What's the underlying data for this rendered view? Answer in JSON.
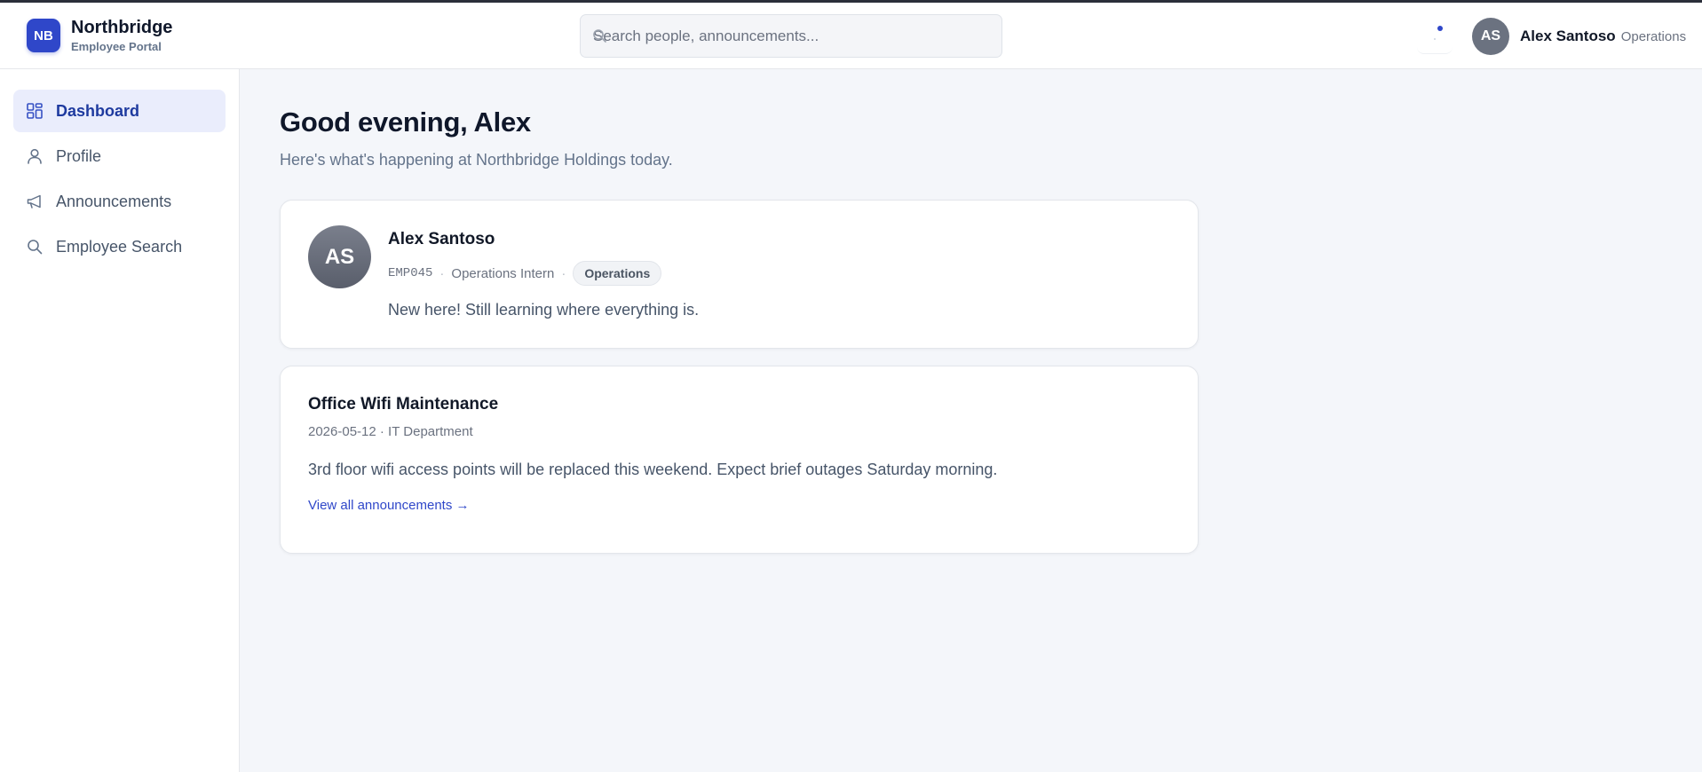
{
  "header": {
    "brand_initials": "NB",
    "brand_name": "Northbridge",
    "brand_subtitle": "Employee Portal",
    "search_placeholder": "Search people, announcements...",
    "user_initials": "AS",
    "user_name": "Alex Santoso",
    "user_department": "Operations"
  },
  "sidebar": {
    "items": [
      {
        "label": "Dashboard",
        "icon": "dashboard-grid-icon",
        "active": true
      },
      {
        "label": "Profile",
        "icon": "user-icon",
        "active": false
      },
      {
        "label": "Announcements",
        "icon": "megaphone-icon",
        "active": false
      },
      {
        "label": "Employee Search",
        "icon": "search-icon",
        "active": false
      }
    ]
  },
  "main": {
    "greeting": "Good evening, Alex",
    "subtitle": "Here's what's happening at Northbridge Holdings today.",
    "profile_card": {
      "initials": "AS",
      "name": "Alex Santoso",
      "employee_id": "EMP045",
      "separator": "·",
      "role": "Operations Intern",
      "department_badge": "Operations",
      "bio": "New here! Still learning where everything is."
    },
    "announcement_card": {
      "title": "Office Wifi Maintenance",
      "meta": "2026-05-12 · IT Department",
      "body": "3rd floor wifi access points will be replaced this weekend. Expect brief outages Saturday morning.",
      "link_label": "View all announcements →"
    }
  },
  "colors": {
    "accent": "#2f47c9",
    "nav_active_bg": "#eaedfc",
    "nav_active_text": "#1e3a9f",
    "page_bg": "#f4f6fa"
  }
}
